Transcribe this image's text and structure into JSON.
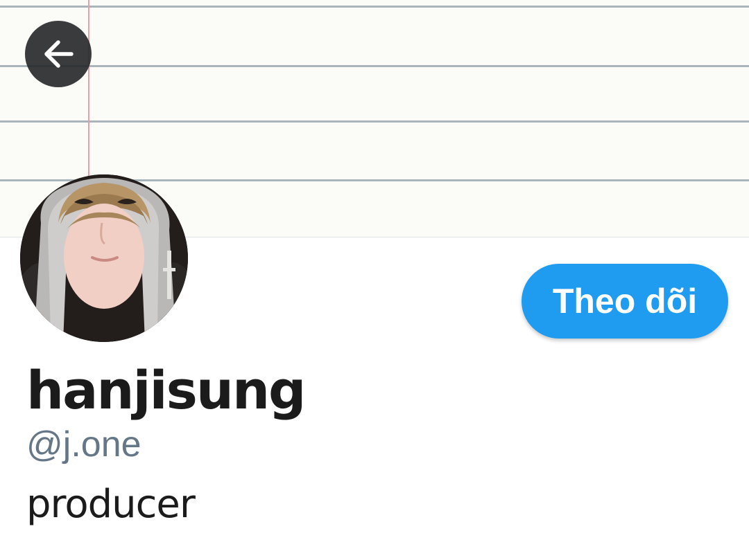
{
  "header": {
    "back_icon": "arrow-left-icon"
  },
  "profile": {
    "display_name": "hanjisung",
    "handle": "@j.one",
    "bio": "producer",
    "follow_label": "Theo dõi"
  },
  "colors": {
    "accent": "#1f9bf0",
    "handle": "#657786",
    "text": "#1b1b1b"
  }
}
